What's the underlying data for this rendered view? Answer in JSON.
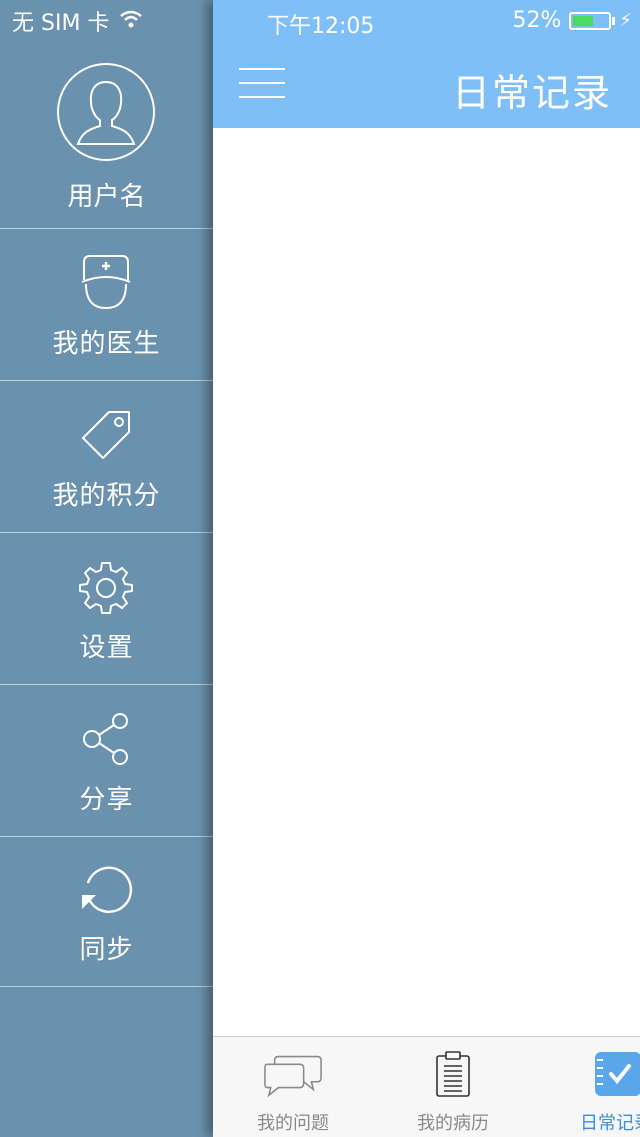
{
  "status_bar": {
    "carrier": "无 SIM 卡",
    "time": "下午12:05",
    "battery": "52%"
  },
  "sidebar": {
    "user": {
      "label": "用户名",
      "icon": "user-avatar-icon"
    },
    "items": [
      {
        "label": "我的医生",
        "icon": "doctor-icon"
      },
      {
        "label": "我的积分",
        "icon": "tag-icon"
      },
      {
        "label": "设置",
        "icon": "gear-icon"
      },
      {
        "label": "分享",
        "icon": "share-icon"
      },
      {
        "label": "同步",
        "icon": "refresh-icon"
      }
    ]
  },
  "header": {
    "title": "日常记录",
    "menu_icon": "hamburger-icon"
  },
  "tabs": [
    {
      "label": "我的问题",
      "icon": "chat-bubbles-icon",
      "active": false
    },
    {
      "label": "我的病历",
      "icon": "clipboard-icon",
      "active": false
    },
    {
      "label": "日常记录",
      "icon": "checked-notebook-icon",
      "active": true
    }
  ],
  "colors": {
    "sidebar_bg": "#6a91ae",
    "header_bg": "#7fbff8",
    "active_tab": "#3a8fe0",
    "battery_fill": "#4cd964"
  }
}
